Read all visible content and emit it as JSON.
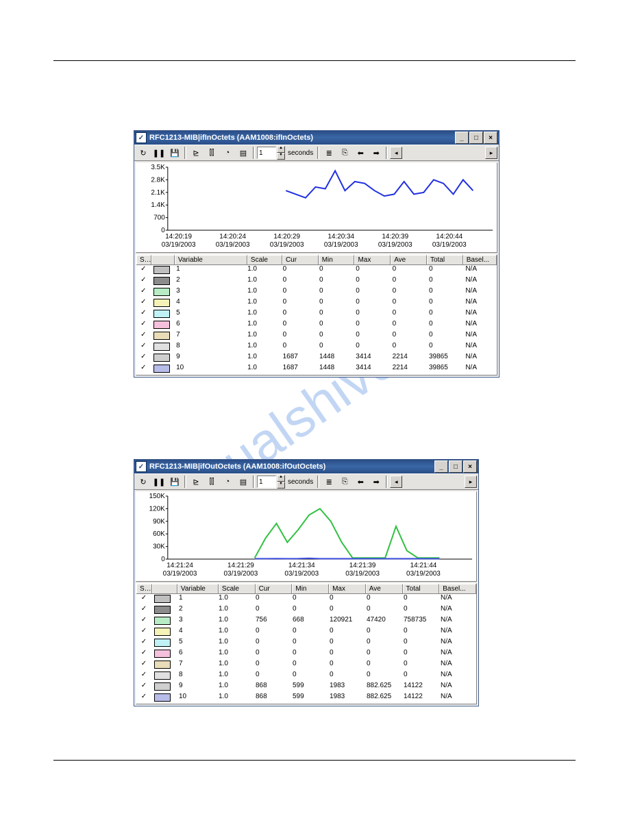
{
  "watermark": "manualshive.com",
  "windows": [
    {
      "title": "RFC1213-MIB|ifInOctets (AAM1008:ifInOctets)",
      "spin_value": "1",
      "units": "seconds",
      "headers": [
        "St...",
        "",
        "Variable",
        "Scale",
        "Cur",
        "Min",
        "Max",
        "Ave",
        "Total",
        "Basel..."
      ],
      "rows": [
        {
          "sw": "c-gray",
          "var": "1",
          "scale": "1.0",
          "cur": "0",
          "min": "0",
          "max": "0",
          "ave": "0",
          "total": "0",
          "bsl": "N/A"
        },
        {
          "sw": "c-dgray",
          "var": "2",
          "scale": "1.0",
          "cur": "0",
          "min": "0",
          "max": "0",
          "ave": "0",
          "total": "0",
          "bsl": "N/A"
        },
        {
          "sw": "c-green",
          "var": "3",
          "scale": "1.0",
          "cur": "0",
          "min": "0",
          "max": "0",
          "ave": "0",
          "total": "0",
          "bsl": "N/A"
        },
        {
          "sw": "c-yel",
          "var": "4",
          "scale": "1.0",
          "cur": "0",
          "min": "0",
          "max": "0",
          "ave": "0",
          "total": "0",
          "bsl": "N/A"
        },
        {
          "sw": "c-cyan",
          "var": "5",
          "scale": "1.0",
          "cur": "0",
          "min": "0",
          "max": "0",
          "ave": "0",
          "total": "0",
          "bsl": "N/A"
        },
        {
          "sw": "c-pink",
          "var": "6",
          "scale": "1.0",
          "cur": "0",
          "min": "0",
          "max": "0",
          "ave": "0",
          "total": "0",
          "bsl": "N/A"
        },
        {
          "sw": "c-tan",
          "var": "7",
          "scale": "1.0",
          "cur": "0",
          "min": "0",
          "max": "0",
          "ave": "0",
          "total": "0",
          "bsl": "N/A"
        },
        {
          "sw": "c-lgray",
          "var": "8",
          "scale": "1.0",
          "cur": "0",
          "min": "0",
          "max": "0",
          "ave": "0",
          "total": "0",
          "bsl": "N/A"
        },
        {
          "sw": "c-mgray",
          "var": "9",
          "scale": "1.0",
          "cur": "1687",
          "min": "1448",
          "max": "3414",
          "ave": "2214",
          "total": "39865",
          "bsl": "N/A"
        },
        {
          "sw": "c-blue",
          "var": "10",
          "scale": "1.0",
          "cur": "1687",
          "min": "1448",
          "max": "3414",
          "ave": "2214",
          "total": "39865",
          "bsl": "N/A"
        }
      ],
      "chart_data": {
        "type": "line",
        "y_ticks": [
          "3.5K",
          "2.8K",
          "2.1K",
          "1.4K",
          "700",
          "0"
        ],
        "ylim": [
          0,
          3500
        ],
        "x_ticks": [
          {
            "t": "14:20:19",
            "d": "03/19/2003"
          },
          {
            "t": "14:20:24",
            "d": "03/19/2003"
          },
          {
            "t": "14:20:29",
            "d": "03/19/2003"
          },
          {
            "t": "14:20:34",
            "d": "03/19/2003"
          },
          {
            "t": "14:20:39",
            "d": "03/19/2003"
          },
          {
            "t": "14:20:44",
            "d": "03/19/2003"
          }
        ],
        "series": [
          {
            "name": "10",
            "color": "#2030e0",
            "x": [
              28,
              29,
              30,
              31,
              32,
              33,
              34,
              35,
              36,
              37,
              38,
              39,
              40,
              41,
              42,
              43,
              44,
              45,
              46,
              47
            ],
            "y": [
              2200,
              2000,
              1800,
              2400,
              2300,
              3300,
              2200,
              2700,
              2600,
              2200,
              1900,
              2000,
              2700,
              2000,
              2100,
              2800,
              2600,
              2000,
              2800,
              2200
            ]
          }
        ]
      }
    },
    {
      "title": "RFC1213-MIB|ifOutOctets (AAM1008:ifOutOctets)",
      "spin_value": "1",
      "units": "seconds",
      "headers": [
        "St...",
        "",
        "Variable",
        "Scale",
        "Cur",
        "Min",
        "Max",
        "Ave",
        "Total",
        "Basel..."
      ],
      "rows": [
        {
          "sw": "c-gray",
          "var": "1",
          "scale": "1.0",
          "cur": "0",
          "min": "0",
          "max": "0",
          "ave": "0",
          "total": "0",
          "bsl": "N/A"
        },
        {
          "sw": "c-dgray",
          "var": "2",
          "scale": "1.0",
          "cur": "0",
          "min": "0",
          "max": "0",
          "ave": "0",
          "total": "0",
          "bsl": "N/A"
        },
        {
          "sw": "c-green",
          "var": "3",
          "scale": "1.0",
          "cur": "756",
          "min": "668",
          "max": "120921",
          "ave": "47420",
          "total": "758735",
          "bsl": "N/A"
        },
        {
          "sw": "c-yel",
          "var": "4",
          "scale": "1.0",
          "cur": "0",
          "min": "0",
          "max": "0",
          "ave": "0",
          "total": "0",
          "bsl": "N/A"
        },
        {
          "sw": "c-cyan",
          "var": "5",
          "scale": "1.0",
          "cur": "0",
          "min": "0",
          "max": "0",
          "ave": "0",
          "total": "0",
          "bsl": "N/A"
        },
        {
          "sw": "c-pink",
          "var": "6",
          "scale": "1.0",
          "cur": "0",
          "min": "0",
          "max": "0",
          "ave": "0",
          "total": "0",
          "bsl": "N/A"
        },
        {
          "sw": "c-tan",
          "var": "7",
          "scale": "1.0",
          "cur": "0",
          "min": "0",
          "max": "0",
          "ave": "0",
          "total": "0",
          "bsl": "N/A"
        },
        {
          "sw": "c-lgray",
          "var": "8",
          "scale": "1.0",
          "cur": "0",
          "min": "0",
          "max": "0",
          "ave": "0",
          "total": "0",
          "bsl": "N/A"
        },
        {
          "sw": "c-mgray",
          "var": "9",
          "scale": "1.0",
          "cur": "868",
          "min": "599",
          "max": "1983",
          "ave": "882.625",
          "total": "14122",
          "bsl": "N/A"
        },
        {
          "sw": "c-blue",
          "var": "10",
          "scale": "1.0",
          "cur": "868",
          "min": "599",
          "max": "1983",
          "ave": "882.625",
          "total": "14122",
          "bsl": "N/A"
        }
      ],
      "chart_data": {
        "type": "line",
        "y_ticks": [
          "150K",
          "120K",
          "90K",
          "60K",
          "30K",
          "0"
        ],
        "ylim": [
          0,
          150000
        ],
        "x_ticks": [
          {
            "t": "14:21:24",
            "d": "03/19/2003"
          },
          {
            "t": "14:21:29",
            "d": "03/19/2003"
          },
          {
            "t": "14:21:34",
            "d": "03/19/2003"
          },
          {
            "t": "14:21:39",
            "d": "03/19/2003"
          },
          {
            "t": "14:21:44",
            "d": "03/19/2003"
          }
        ],
        "series": [
          {
            "name": "3",
            "color": "#30c040",
            "x": [
              29,
              30,
              31,
              32,
              33,
              34,
              35,
              36,
              37,
              38,
              39,
              40,
              41,
              42,
              43,
              44,
              45,
              46
            ],
            "y": [
              3000,
              50000,
              85000,
              40000,
              70000,
              105000,
              120000,
              90000,
              40000,
              3000,
              3000,
              3000,
              3000,
              78000,
              20000,
              3000,
              3000,
              3000
            ]
          },
          {
            "name": "10",
            "color": "#4050e0",
            "x": [
              29,
              30,
              31,
              32,
              33,
              34,
              35,
              36,
              37,
              38,
              39,
              40,
              41,
              42,
              43,
              44,
              45,
              46
            ],
            "y": [
              900,
              1000,
              1100,
              900,
              1200,
              1900,
              900,
              900,
              900,
              900,
              900,
              900,
              900,
              900,
              900,
              900,
              900,
              900
            ]
          }
        ]
      }
    }
  ]
}
